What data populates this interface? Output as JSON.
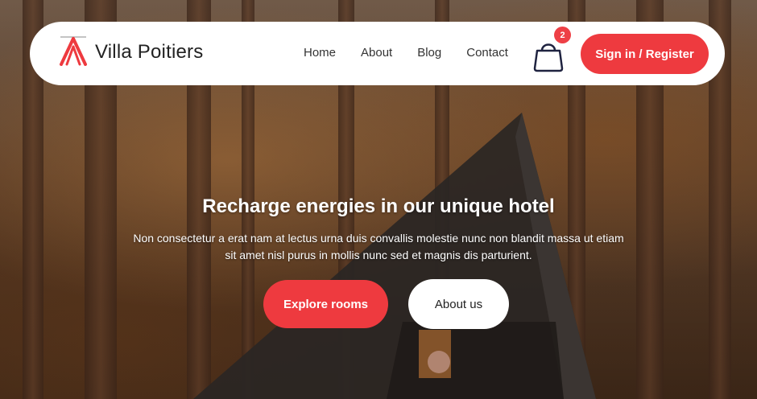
{
  "header": {
    "brand": "Villa Poitiers",
    "logo_icon": "a-frame-logo-icon",
    "nav": [
      {
        "label": "Home"
      },
      {
        "label": "About"
      },
      {
        "label": "Blog"
      },
      {
        "label": "Contact"
      }
    ],
    "cart_icon": "shopping-bag-icon",
    "cart_count": "2",
    "signin_label": "Sign in / Register"
  },
  "hero": {
    "headline": "Recharge energies in our unique hotel",
    "subtext": "Non consectetur a erat nam at lectus urna duis convallis molestie nunc non blandit massa ut etiam sit amet nisl purus in mollis nunc sed et magnis dis parturient.",
    "primary_button": "Explore rooms",
    "secondary_button": "About us",
    "background": "forest-a-frame-cabin-photo"
  },
  "colors": {
    "accent": "#ee3a3f",
    "navbar_bg": "#ffffff",
    "cart_stroke": "#1f2340"
  }
}
